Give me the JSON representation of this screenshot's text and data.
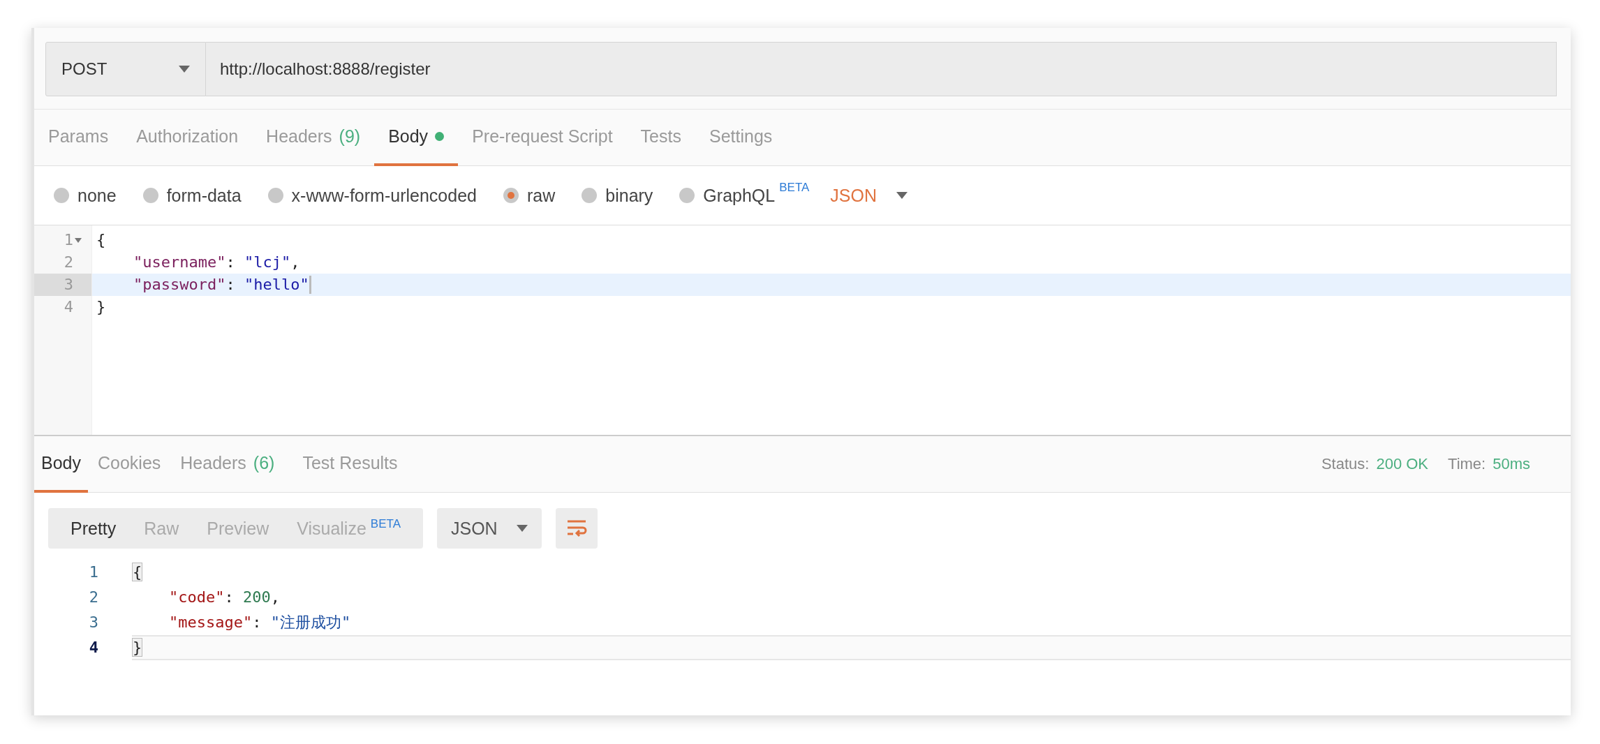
{
  "request": {
    "method": "POST",
    "url": "http://localhost:8888/register"
  },
  "request_tabs": [
    {
      "label": "Params",
      "selected": false,
      "modified": false
    },
    {
      "label": "Authorization",
      "selected": false,
      "modified": false
    },
    {
      "label": "Headers",
      "count": "(9)",
      "selected": false,
      "modified": false
    },
    {
      "label": "Body",
      "selected": true,
      "modified": true
    },
    {
      "label": "Pre-request Script",
      "selected": false,
      "modified": false
    },
    {
      "label": "Tests",
      "selected": false,
      "modified": false
    },
    {
      "label": "Settings",
      "selected": false,
      "modified": false
    }
  ],
  "body_types": [
    {
      "label": "none",
      "selected": false
    },
    {
      "label": "form-data",
      "selected": false
    },
    {
      "label": "x-www-form-urlencoded",
      "selected": false
    },
    {
      "label": "raw",
      "selected": true
    },
    {
      "label": "binary",
      "selected": false
    },
    {
      "label": "GraphQL",
      "badge": "BETA",
      "selected": false
    }
  ],
  "body_format": "JSON",
  "request_editor": {
    "lines": [
      {
        "number": "1",
        "foldable": true,
        "active": false,
        "cursor": false,
        "tokens": [
          {
            "kind": "punct",
            "text": "{"
          }
        ],
        "children": [
          {
            "number": "2",
            "foldable": false,
            "active": false,
            "cursor": false,
            "tokens": [
              {
                "kind": "key",
                "text": "\"username\""
              },
              {
                "kind": "punct",
                "text": ": "
              },
              {
                "kind": "string",
                "text": "\"lcj\""
              },
              {
                "kind": "punct",
                "text": ","
              }
            ]
          },
          {
            "number": "3",
            "foldable": false,
            "active": true,
            "cursor": true,
            "tokens": [
              {
                "kind": "key",
                "text": "\"password\""
              },
              {
                "kind": "punct",
                "text": ": "
              },
              {
                "kind": "string",
                "text": "\"hello\""
              }
            ]
          }
        ]
      },
      {
        "number": "4",
        "foldable": false,
        "active": false,
        "cursor": false,
        "tokens": [
          {
            "kind": "punct",
            "text": "}"
          }
        ]
      }
    ]
  },
  "response_tabs": [
    {
      "label": "Body",
      "selected": true
    },
    {
      "label": "Cookies",
      "selected": false
    },
    {
      "label": "Headers",
      "count": "(6)",
      "selected": false
    },
    {
      "label": "Test Results",
      "selected": false
    }
  ],
  "response_meta": [
    {
      "label": "Status:",
      "value": "200 OK"
    },
    {
      "label": "Time:",
      "value": "50ms"
    }
  ],
  "view_modes": [
    {
      "label": "Pretty",
      "selected": true
    },
    {
      "label": "Raw",
      "selected": false
    },
    {
      "label": "Preview",
      "selected": false
    },
    {
      "label": "Visualize",
      "badge": "BETA",
      "selected": false
    }
  ],
  "response_format": "JSON",
  "response_editor": {
    "lines": [
      {
        "number": "1",
        "active": false,
        "tokens": [
          {
            "kind": "brace",
            "text": "{"
          }
        ],
        "children": [
          {
            "number": "2",
            "active": false,
            "tokens": [
              {
                "kind": "key",
                "text": "\"code\""
              },
              {
                "kind": "punct",
                "text": ": "
              },
              {
                "kind": "number",
                "text": "200"
              },
              {
                "kind": "punct",
                "text": ","
              }
            ]
          },
          {
            "number": "3",
            "active": false,
            "tokens": [
              {
                "kind": "key",
                "text": "\"message\""
              },
              {
                "kind": "punct",
                "text": ": "
              },
              {
                "kind": "string",
                "text": "\"注册成功\""
              }
            ]
          }
        ]
      },
      {
        "number": "4",
        "active": true,
        "tokens": [
          {
            "kind": "brace",
            "text": "}"
          }
        ]
      }
    ]
  }
}
